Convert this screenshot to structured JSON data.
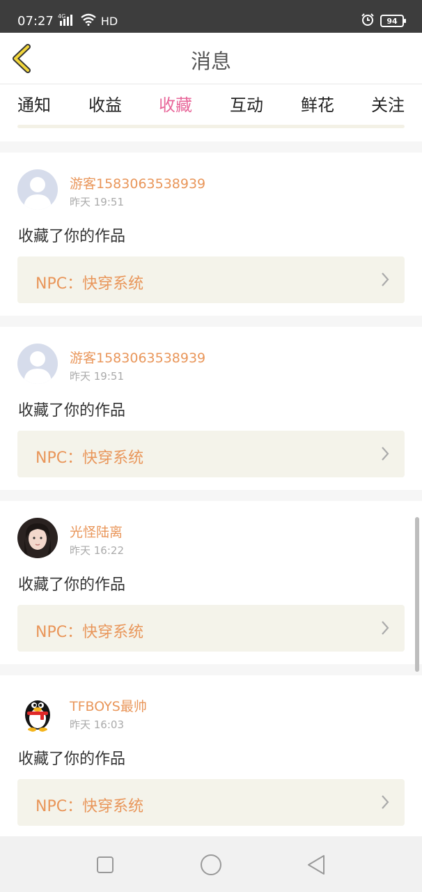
{
  "status_bar": {
    "time": "07:27",
    "network": "4G",
    "hd": "HD",
    "battery": "94"
  },
  "header": {
    "title": "消息",
    "back_icon": "chevron-left-icon"
  },
  "tabs": [
    {
      "label": "通知",
      "active": false
    },
    {
      "label": "收益",
      "active": false
    },
    {
      "label": "收藏",
      "active": true
    },
    {
      "label": "互动",
      "active": false
    },
    {
      "label": "鲜花",
      "active": false
    },
    {
      "label": "关注",
      "active": false
    }
  ],
  "messages": [
    {
      "username": "游客1583063538939",
      "time": "昨天 19:51",
      "action": "收藏了你的作品",
      "work": "NPC：快穿系统",
      "avatar": "default-avatar"
    },
    {
      "username": "游客1583063538939",
      "time": "昨天 19:51",
      "action": "收藏了你的作品",
      "work": "NPC：快穿系统",
      "avatar": "default-avatar"
    },
    {
      "username": "光怪陆离",
      "time": "昨天 16:22",
      "action": "收藏了你的作品",
      "work": "NPC：快穿系统",
      "avatar": "photo-avatar"
    },
    {
      "username": "TFBOYS最帅",
      "time": "昨天 16:03",
      "action": "收藏了你的作品",
      "work": "NPC：快穿系统",
      "avatar": "penguin-avatar"
    }
  ],
  "colors": {
    "accent": "#e8679a",
    "username": "#e9965a",
    "work_box": "#f4f3ea"
  }
}
